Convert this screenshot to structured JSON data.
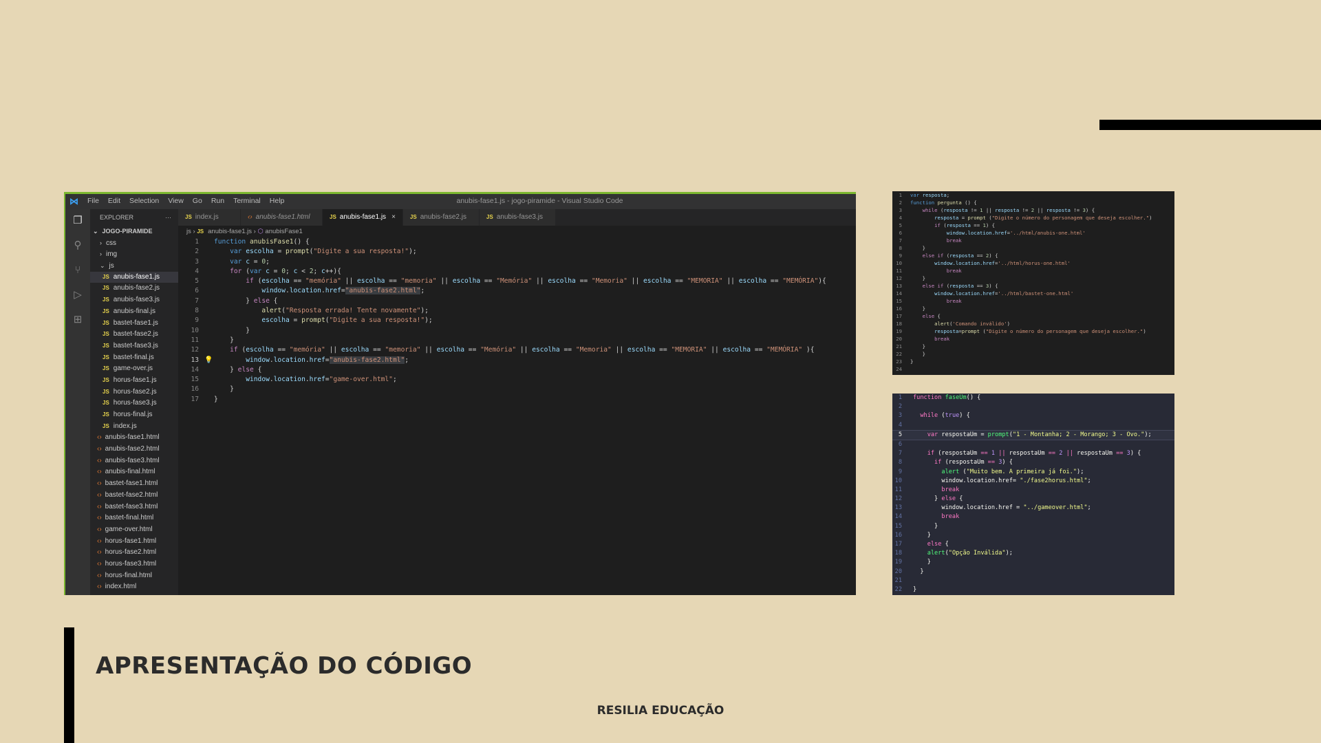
{
  "slide": {
    "title": "APRESENTAÇÃO DO CÓDIGO",
    "footer": "RESILIA EDUCAÇÃO"
  },
  "vscode": {
    "menu": [
      "File",
      "Edit",
      "Selection",
      "View",
      "Go",
      "Run",
      "Terminal",
      "Help"
    ],
    "window_title": "anubis-fase1.js - jogo-piramide - Visual Studio Code",
    "explorer_label": "EXPLORER",
    "explorer_more": "···",
    "project": "JOGO-PIRAMIDE",
    "folders": [
      "css",
      "img",
      "js"
    ],
    "js_files": [
      "anubis-fase1.js",
      "anubis-fase2.js",
      "anubis-fase3.js",
      "anubis-final.js",
      "bastet-fase1.js",
      "bastet-fase2.js",
      "bastet-fase3.js",
      "bastet-final.js",
      "game-over.js",
      "horus-fase1.js",
      "horus-fase2.js",
      "horus-fase3.js",
      "horus-final.js",
      "index.js"
    ],
    "html_files": [
      "anubis-fase1.html",
      "anubis-fase2.html",
      "anubis-fase3.html",
      "anubis-final.html",
      "bastet-fase1.html",
      "bastet-fase2.html",
      "bastet-fase3.html",
      "bastet-final.html",
      "game-over.html",
      "horus-fase1.html",
      "horus-fase2.html",
      "horus-fase3.html",
      "horus-final.html",
      "index.html"
    ],
    "tabs": [
      "index.js",
      "anubis-fase1.html",
      "anubis-fase1.js",
      "anubis-fase2.js",
      "anubis-fase3.js"
    ],
    "active_tab_close": "×",
    "breadcrumb": {
      "folder": "js",
      "file": "anubis-fase1.js",
      "symbol": "anubisFase1"
    },
    "current_line": 13
  },
  "icons": {
    "activity": [
      "files-icon",
      "search-icon",
      "source-control-icon",
      "run-debug-icon",
      "extensions-icon"
    ],
    "lightbulb": "lightbulb-icon"
  },
  "snippet1": {
    "line_count": 24
  },
  "snippet2": {
    "line_count": 22
  }
}
